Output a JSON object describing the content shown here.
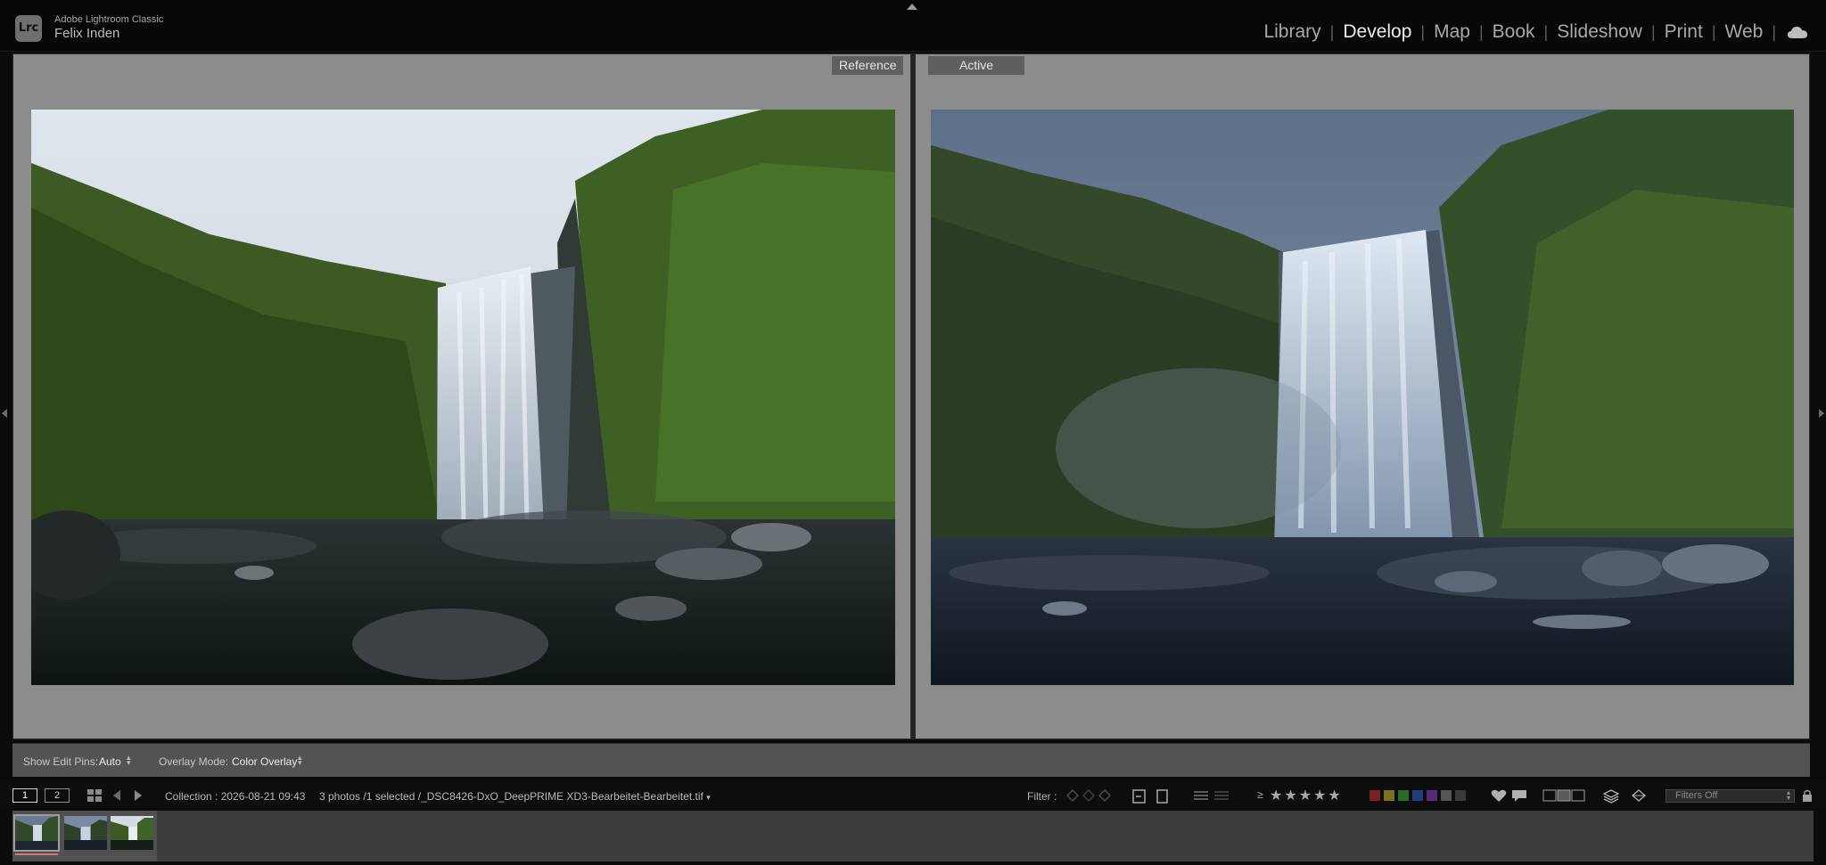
{
  "app": {
    "logo_text": "Lrc",
    "product_name": "Adobe Lightroom Classic",
    "user_name": "Felix Inden"
  },
  "modules": [
    {
      "label": "Library",
      "active": false
    },
    {
      "label": "Develop",
      "active": true
    },
    {
      "label": "Map",
      "active": false
    },
    {
      "label": "Book",
      "active": false
    },
    {
      "label": "Slideshow",
      "active": false
    },
    {
      "label": "Print",
      "active": false
    },
    {
      "label": "Web",
      "active": false
    }
  ],
  "module_separator": "|",
  "icons": {
    "cloud": "cloud-icon",
    "grid": "grid-icon",
    "prev": "arrow-left-icon",
    "next": "arrow-right-icon"
  },
  "compare": {
    "reference_label": "Reference",
    "active_label": "Active"
  },
  "toolbar": {
    "edit_pins_label": "Show Edit Pins:",
    "edit_pins_value": "Auto",
    "overlay_label": "Overlay Mode:",
    "overlay_value": "Color Overlay"
  },
  "filmstrip_header": {
    "screen1": "1",
    "screen2": "2",
    "collection": "Collection : 2026-08-21 09:43",
    "selection": "3 photos /1 selected /_DSC8426-DxO_DeepPRIME XD3-Bearbeitet-Bearbeitet.tif",
    "filter_label": "Filter :",
    "rating_op": "≥",
    "filters_value": "Filters Off",
    "color_labels": [
      "#7a2020",
      "#7a7020",
      "#2a6a2a",
      "#203f7a",
      "#5a2a7a",
      "#555555",
      "#3a3a3a"
    ]
  },
  "colors": {
    "accent_selected": "#e07878",
    "panel_bg": "#8a8a8a"
  }
}
